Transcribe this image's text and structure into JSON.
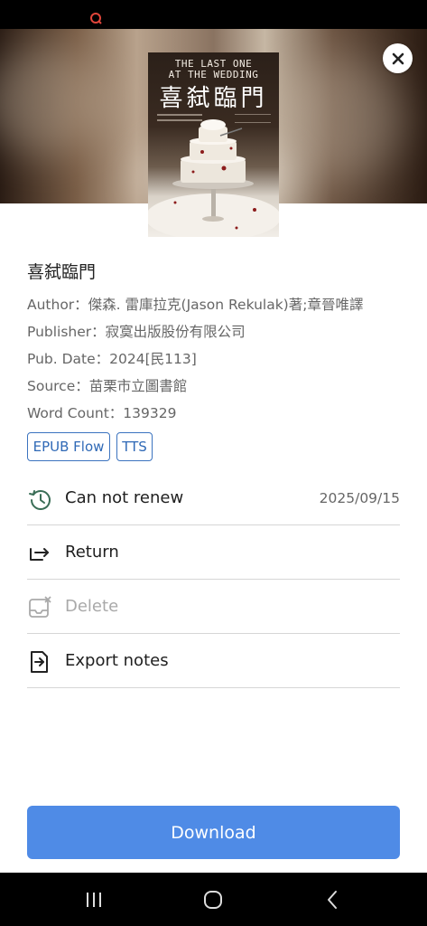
{
  "book": {
    "title": "喜弑臨門",
    "author_line": "Author：傑森. 雷庫拉克(Jason Rekulak)著;章晉唯譯",
    "publisher_line": "Publisher：寂寞出版股份有限公司",
    "pub_date_line": "Pub. Date：2024[民113]",
    "source_line": "Source：苗栗市立圖書館",
    "word_count_line": "Word Count：139329",
    "cover": {
      "en_title_1": "THE LAST ONE",
      "en_title_2": "AT THE WEDDING",
      "zh_title": "喜弑臨門"
    }
  },
  "tags": [
    "EPUB Flow",
    "TTS"
  ],
  "actions": {
    "renew_label": "Can not renew",
    "due_date": "2025/09/15",
    "return_label": "Return",
    "delete_label": "Delete",
    "export_label": "Export notes"
  },
  "download_label": "Download",
  "colors": {
    "accent": "#4f8be6",
    "tag_border": "#3b73bf",
    "disabled_text": "#a9a9a9",
    "status_bar": "#000000"
  },
  "icons": {
    "status": "notification-icon",
    "close": "close-icon",
    "renew": "history-icon",
    "return": "return-arrow-icon",
    "delete": "delete-tray-icon",
    "export": "export-file-icon",
    "nav_recent": "recent-apps-icon",
    "nav_home": "home-icon",
    "nav_back": "back-icon"
  }
}
